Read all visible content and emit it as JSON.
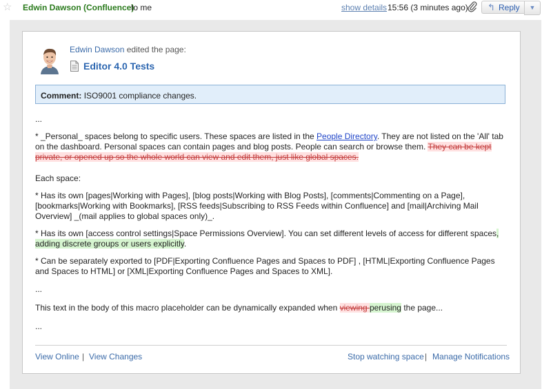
{
  "header": {
    "sender": "Edwin Dawson (Confluence)",
    "recipient": "to me",
    "show_details": "show details",
    "time": "15:56 (3 minutes ago)",
    "reply_label": "Reply"
  },
  "notification": {
    "editor_name": "Edwin Dawson",
    "action_text": "edited the page:",
    "page_title": "Editor 4.0 Tests",
    "comment_label": "Comment:",
    "comment_text": "ISO9001 compliance changes."
  },
  "content": {
    "ellipsis": "...",
    "para1_prefix": "* _Personal_ spaces belong to specific users. These spaces are listed in the ",
    "para1_link": "People Directory",
    "para1_middle": ". They are not listed on the 'All' tab on the dashboard. Personal spaces can contain pages and blog posts. People can search or browse them. ",
    "para1_deleted": "They can be kept private, or opened up so the whole world can view and edit them, just like global spaces.",
    "each_space": "Each space:",
    "para2": "* Has its own [pages|Working with Pages], [blog posts|Working with Blog Posts], [comments|Commenting on a Page], [bookmarks|Working with Bookmarks], [RSS feeds|Subscribing to RSS Feeds within Confluence] and [mail|Archiving Mail Overview] _(mail applies to global spaces only)_.",
    "para3_prefix": "* Has its own [access control settings|Space Permissions Overview]. You can set different levels of access for different spaces",
    "para3_inserted": ", adding discrete groups or users explicitly",
    "para3_suffix": ".",
    "para4": "* Can be separately exported to [PDF|Exporting Confluence Pages and Spaces to PDF] , [HTML|Exporting Confluence Pages and Spaces to HTML] or [XML|Exporting Confluence Pages and Spaces to XML].",
    "para5_prefix": "This text in the body of this macro placeholder can be dynamically expanded when ",
    "para5_deleted": "viewing ",
    "para5_inserted": "perusing",
    "para5_suffix": " the page..."
  },
  "footer": {
    "view_online": "View Online",
    "view_changes": "View Changes",
    "stop_watching": "Stop watching space",
    "manage_notifications": "Manage Notifications",
    "separator": "|"
  },
  "icons": {
    "star": "star-icon",
    "attachment": "paperclip-icon",
    "reply": "reply-arrow-icon",
    "dropdown": "chevron-down-icon",
    "page": "document-icon"
  },
  "colors": {
    "sender": "#2a7a1c",
    "link": "#3a6aa8",
    "comment_bg": "#e1eefa",
    "deleted_bg": "#ffe1e1",
    "inserted_bg": "#d6f5d0"
  }
}
